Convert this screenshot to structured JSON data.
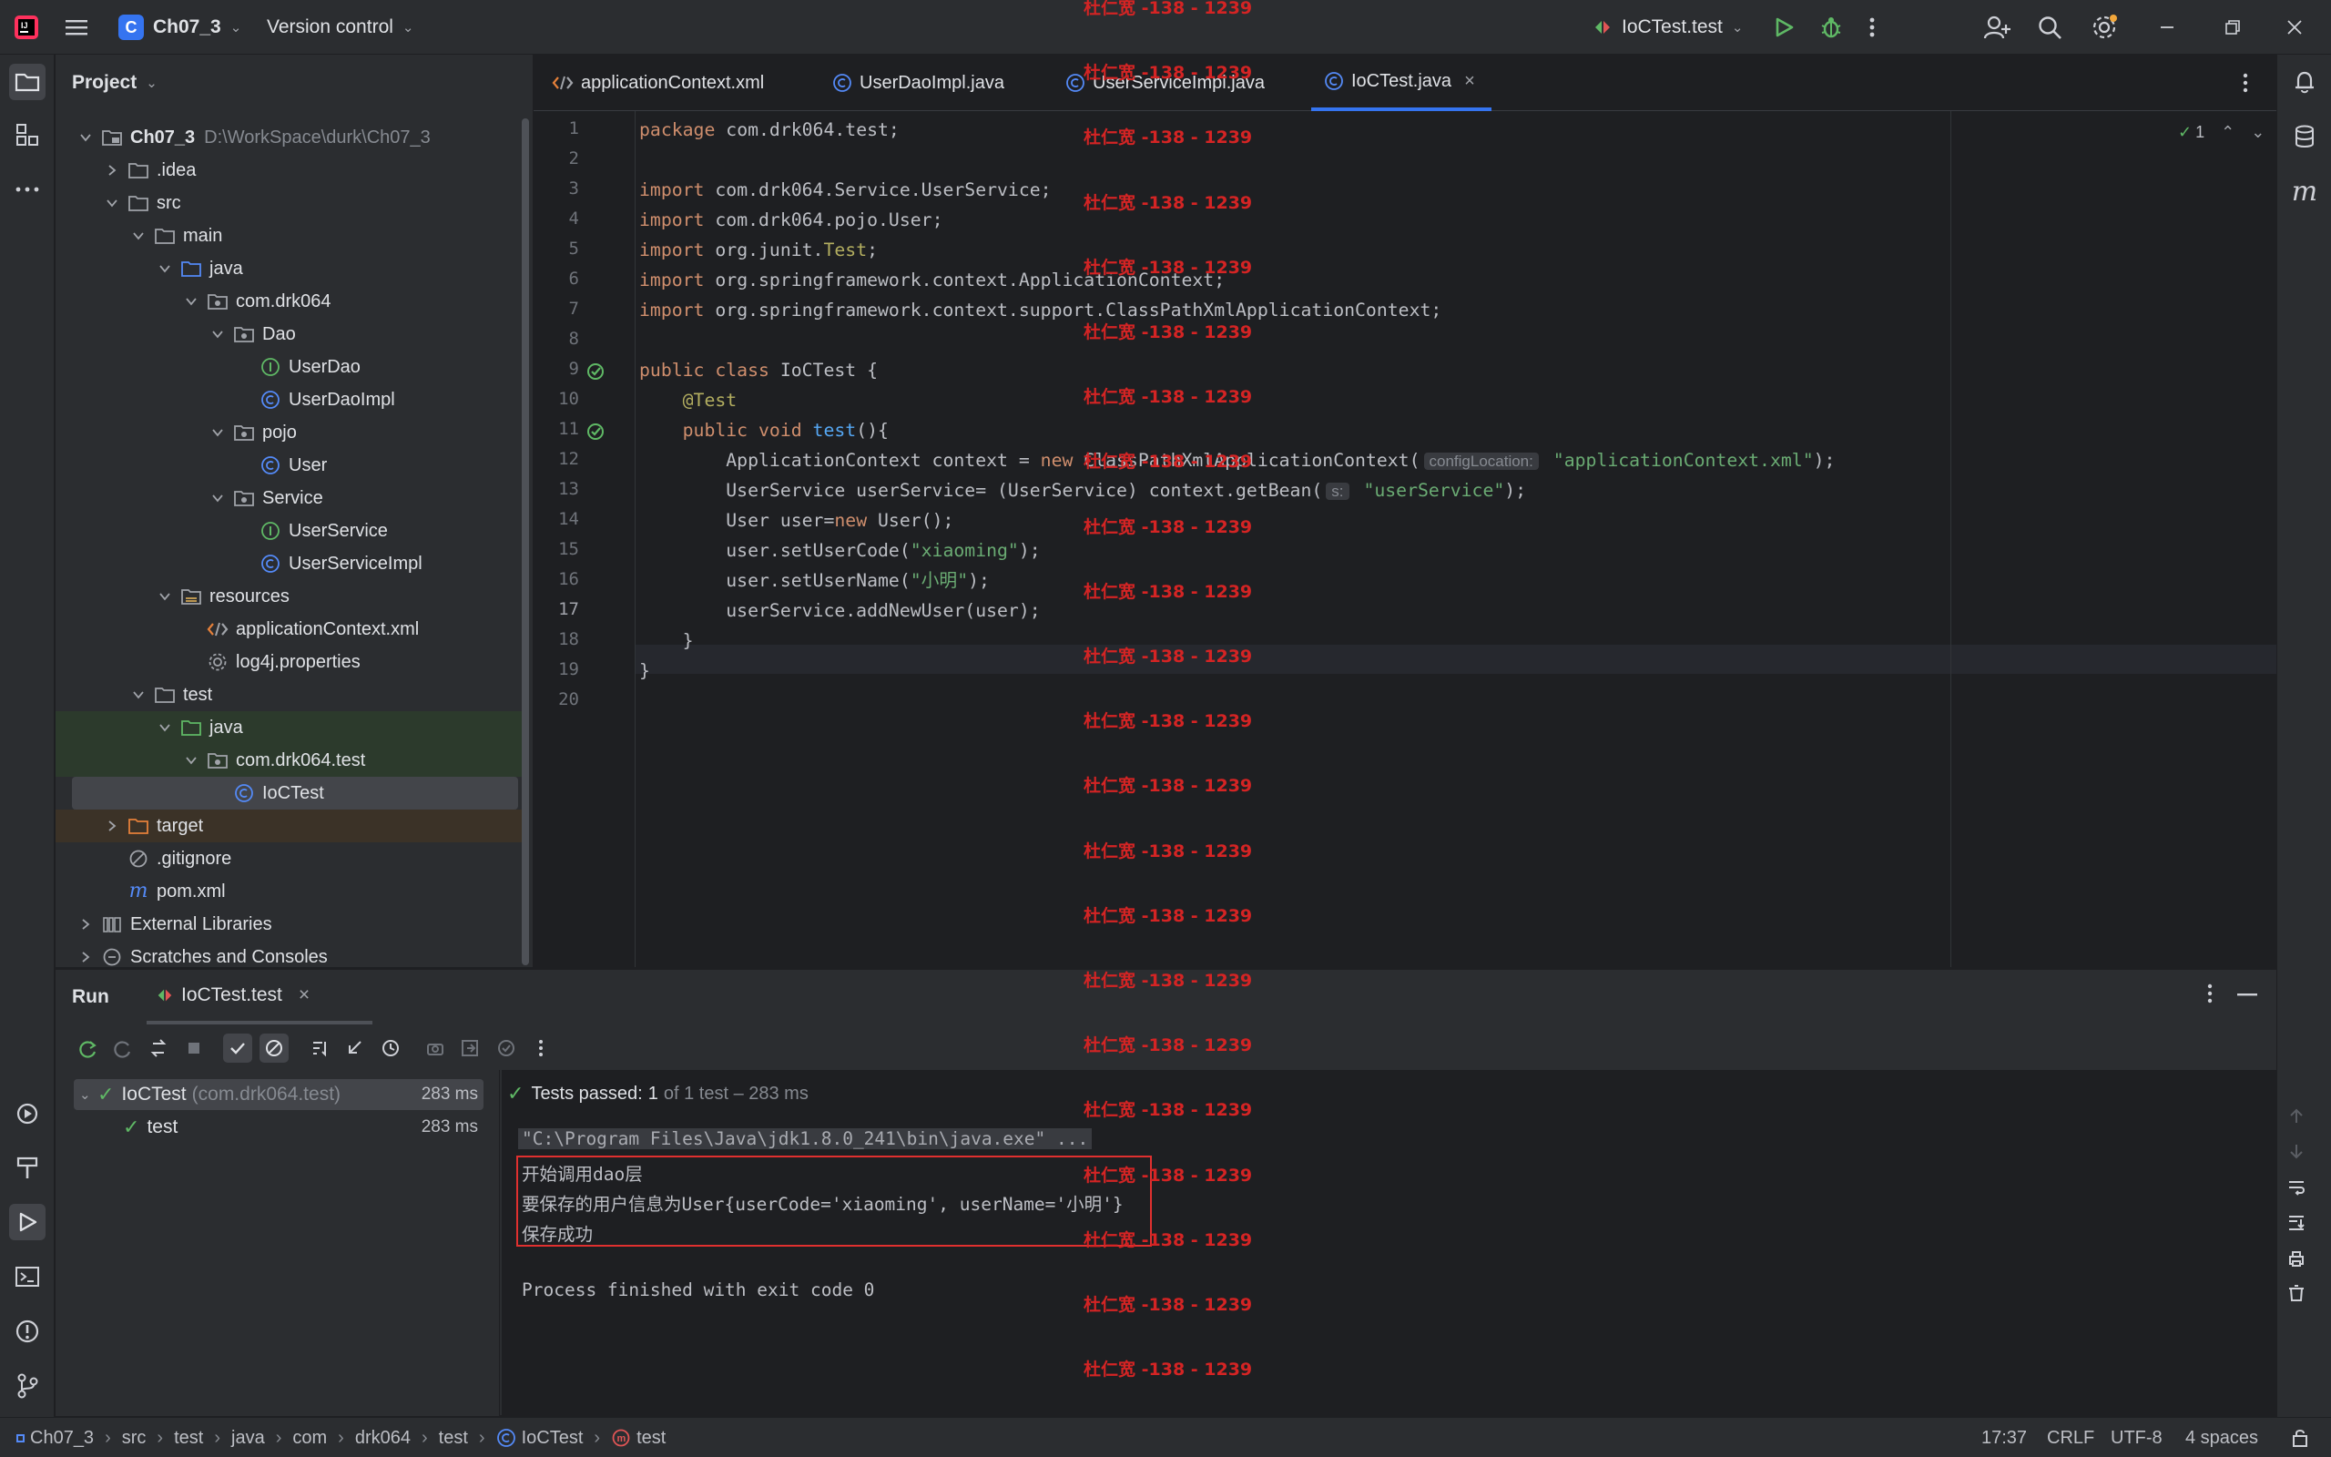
{
  "titlebar": {
    "project_badge": "C",
    "project_name": "Ch07_3",
    "vcs_label": "Version control",
    "run_config": "IoCTest.test"
  },
  "project_panel": {
    "title": "Project",
    "tree": [
      {
        "label": "Ch07_3",
        "hint": "D:\\WorkSpace\\durk\\Ch07_3",
        "icon": "module-folder-icon"
      },
      {
        "label": ".idea",
        "icon": "folder-icon"
      },
      {
        "label": "src",
        "icon": "folder-icon"
      },
      {
        "label": "main",
        "icon": "folder-icon"
      },
      {
        "label": "java",
        "icon": "source-folder-icon"
      },
      {
        "label": "com.drk064",
        "icon": "package-icon"
      },
      {
        "label": "Dao",
        "icon": "package-icon"
      },
      {
        "label": "UserDao",
        "icon": "interface-icon"
      },
      {
        "label": "UserDaoImpl",
        "icon": "class-icon"
      },
      {
        "label": "pojo",
        "icon": "package-icon"
      },
      {
        "label": "User",
        "icon": "class-icon"
      },
      {
        "label": "Service",
        "icon": "package-icon"
      },
      {
        "label": "UserService",
        "icon": "interface-icon"
      },
      {
        "label": "UserServiceImpl",
        "icon": "class-icon"
      },
      {
        "label": "resources",
        "icon": "resources-folder-icon"
      },
      {
        "label": "applicationContext.xml",
        "icon": "xml-file-icon"
      },
      {
        "label": "log4j.properties",
        "icon": "properties-file-icon"
      },
      {
        "label": "test",
        "icon": "folder-icon"
      },
      {
        "label": "java",
        "icon": "test-source-folder-icon"
      },
      {
        "label": "com.drk064.test",
        "icon": "package-icon"
      },
      {
        "label": "IoCTest",
        "icon": "class-icon"
      },
      {
        "label": "target",
        "icon": "excluded-folder-icon"
      },
      {
        "label": ".gitignore",
        "icon": "gitignore-file-icon"
      },
      {
        "label": "pom.xml",
        "icon": "maven-file-icon"
      },
      {
        "label": "External Libraries",
        "icon": "libraries-icon"
      },
      {
        "label": "Scratches and Consoles",
        "icon": "scratches-icon"
      }
    ]
  },
  "editor": {
    "tabs": [
      {
        "label": "applicationContext.xml",
        "icon": "xml-file-icon"
      },
      {
        "label": "UserDaoImpl.java",
        "icon": "class-icon"
      },
      {
        "label": "UserServiceImpl.java",
        "icon": "class-icon"
      },
      {
        "label": "IoCTest.java",
        "icon": "class-icon"
      }
    ],
    "inspection_count": "1",
    "line_numbers": [
      "1",
      "2",
      "3",
      "4",
      "5",
      "6",
      "7",
      "8",
      "9",
      "10",
      "11",
      "12",
      "13",
      "14",
      "15",
      "16",
      "17",
      "18",
      "19",
      "20"
    ],
    "code": {
      "l1_kw": "package",
      "l1_rest": " com.drk064.test;",
      "l3_kw": "import",
      "l3_rest": " com.drk064.Service.UserService;",
      "l4_kw": "import",
      "l4_rest": " com.drk064.pojo.User;",
      "l5_kw": "import",
      "l5_rest": " org.junit.",
      "l5_ann": "Test",
      "l5_end": ";",
      "l6_kw": "import",
      "l6_rest": " org.springframework.context.ApplicationContext;",
      "l7_kw": "import",
      "l7_rest": " org.springframework.context.support.ClassPathXmlApplicationContext;",
      "l9_kw": "public class",
      "l9_rest": " IoCTest {",
      "l10_ann": "    @Test",
      "l11_kw": "    public void",
      "l11_fn": " test",
      "l11_rest": "(){",
      "l12_a": "        ApplicationContext context = ",
      "l12_kw": "new",
      "l12_b": " ClassPathXmlApplicationContext(",
      "l12_hint": "configLocation:",
      "l12_str": " \"applicationContext.xml\"",
      "l12_end": ");",
      "l13_a": "        UserService userService= (UserService) context.getBean(",
      "l13_hint": "s:",
      "l13_str": " \"userService\"",
      "l13_end": ");",
      "l14_a": "        User user=",
      "l14_kw": "new",
      "l14_b": " User();",
      "l15_a": "        user.setUserCode(",
      "l15_str": "\"xiaoming\"",
      "l15_end": ");",
      "l16_a": "        user.setUserName(",
      "l16_str": "\"小明\"",
      "l16_end": ");",
      "l17_a": "        userService.addNewUser(user);",
      "l18_a": "    }",
      "l19_a": "}"
    }
  },
  "watermark": "杜仁宽 -138 - 1239",
  "run_panel": {
    "title": "Run",
    "tab_label": "IoCTest.test",
    "tests": [
      {
        "name": "IoCTest",
        "pkg": "(com.drk064.test)",
        "time": "283 ms"
      },
      {
        "name": "test",
        "pkg": "",
        "time": "283 ms"
      }
    ],
    "status_prefix": "Tests passed:",
    "status_count": "1",
    "status_rest": "of 1 test – 283 ms",
    "console": {
      "cmd": "\"C:\\Program Files\\Java\\jdk1.8.0_241\\bin\\java.exe\" ...",
      "out1": "开始调用dao层",
      "out2": "要保存的用户信息为User{userCode='xiaoming', userName='小明'}",
      "out3": "保存成功",
      "exit": "Process finished with exit code 0"
    }
  },
  "statusbar": {
    "breadcrumb": [
      "Ch07_3",
      "src",
      "test",
      "java",
      "com",
      "drk064",
      "test",
      "IoCTest",
      "test"
    ],
    "cursor": "17:37",
    "line_sep": "CRLF",
    "encoding": "UTF-8",
    "indent": "4 spaces"
  },
  "colors": {
    "accent": "#3574f0",
    "success": "#5fb865",
    "watermark": "#d42424",
    "highlight_box": "#e0302f"
  }
}
